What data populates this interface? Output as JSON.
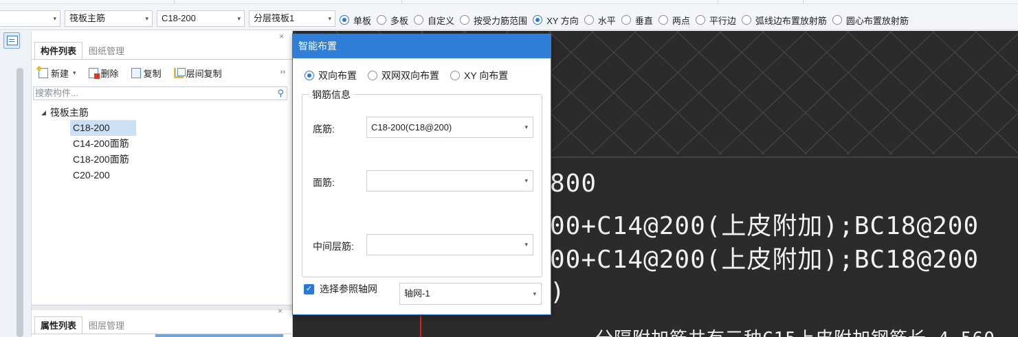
{
  "toolbar": {
    "combo_empty_arrow": "▾",
    "combo1": "筏板主筋",
    "combo2": "C18-200",
    "combo3": "分层筏板1",
    "placement_modes": [
      {
        "label": "单板",
        "checked": true
      },
      {
        "label": "多板",
        "checked": false
      },
      {
        "label": "自定义",
        "checked": false
      },
      {
        "label": "按受力筋范围",
        "checked": false
      },
      {
        "label": "XY 方向",
        "checked": true
      },
      {
        "label": "水平",
        "checked": false
      },
      {
        "label": "垂直",
        "checked": false
      },
      {
        "label": "两点",
        "checked": false
      },
      {
        "label": "平行边",
        "checked": false
      },
      {
        "label": "弧线边布置放射筋",
        "checked": false
      },
      {
        "label": "圆心布置放射筋",
        "checked": false
      }
    ]
  },
  "component_panel": {
    "tabs": [
      "构件列表",
      "图纸管理"
    ],
    "active_tab": "构件列表",
    "actions": {
      "new": "新建",
      "delete": "删除",
      "copy": "复制",
      "layer_copy": "层间复制"
    },
    "search_placeholder": "搜索构件...",
    "tree": {
      "root": "筏板主筋",
      "children": [
        "C18-200",
        "C14-200面筋",
        "C18-200面筋",
        "C20-200"
      ],
      "selected": "C18-200"
    },
    "bottom_tabs": [
      "属性列表",
      "图层管理"
    ]
  },
  "dialog": {
    "title": "智能布置",
    "modes": [
      {
        "label": "双向布置",
        "checked": true
      },
      {
        "label": "双网双向布置",
        "checked": false
      },
      {
        "label": "XY 向布置",
        "checked": false
      }
    ],
    "group_title": "钢筋信息",
    "bottom_rebar_label": "底筋:",
    "bottom_rebar_value": "C18-200(C18@200)",
    "top_rebar_label": "面筋:",
    "top_rebar_value": "",
    "middle_rebar_label": "中间层筋:",
    "middle_rebar_value": "",
    "ref_axis_label": "选择参照轴网",
    "ref_axis_checked": true,
    "ref_axis_value": "轴网-1"
  },
  "canvas": {
    "text_lines": [
      "800",
      "00+C14@200(上皮附加);BC18@200",
      "00+C14@200(上皮附加);BC18@200",
      ")"
    ],
    "bottom_text": "分隔附加筋共有三种C15上皮附加钢筋长 4.560"
  },
  "colors": {
    "accent": "#2f7fd8",
    "canvas_bg": "#2b2b2b",
    "selected_row": "#cce0f5"
  }
}
